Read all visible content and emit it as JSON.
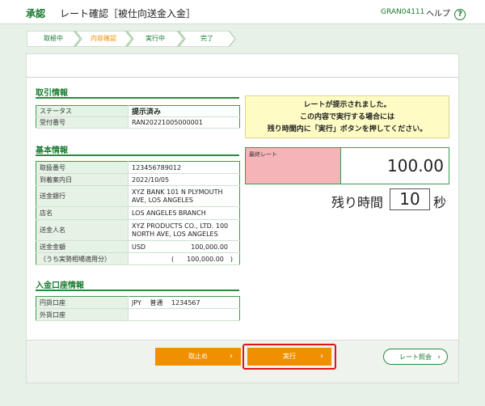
{
  "header": {
    "app_label": "承認",
    "title": "レート確認［被仕向送金入金］",
    "screen_code": "GRAN04111",
    "help_label": "ヘルプ",
    "help_icon_glyph": "?"
  },
  "steps": [
    {
      "label": "取極中"
    },
    {
      "label": "内容確認",
      "active": true
    },
    {
      "label": "実行中"
    },
    {
      "label": "完了"
    }
  ],
  "transaction": {
    "section_title": "取引情報",
    "rows": [
      {
        "label": "ステータス",
        "value": "提示済み"
      },
      {
        "label": "受付番号",
        "value": "RAN20221005000001"
      }
    ]
  },
  "basic": {
    "section_title": "基本情報",
    "rows": [
      {
        "label": "取扱番号",
        "value": "123456789012"
      },
      {
        "label": "到着案内日",
        "value": "2022/10/05"
      },
      {
        "label": "送金銀行",
        "value": "XYZ BANK 101 N PLYMOUTH AVE, LOS ANGELES"
      },
      {
        "label": "店名",
        "value": "LOS ANGELES BRANCH"
      },
      {
        "label": "送金人名",
        "value": "XYZ PRODUCTS CO., LTD. 100 NORTH AVE, LOS ANGELES"
      },
      {
        "label": "送金金額",
        "currency": "USD",
        "value": "100,000.00"
      },
      {
        "label": "（うち実勢相場適用分）",
        "value": "(　　100,000.00　)"
      }
    ]
  },
  "deposit": {
    "section_title": "入金口座情報",
    "rows": [
      {
        "label": "円貨口座",
        "value": "JPY　 普通　 1234567"
      },
      {
        "label": "外貨口座",
        "value": ""
      }
    ]
  },
  "notice": {
    "line1": "レートが提示されました。",
    "line2": "この内容で実行する場合には",
    "line3": "残り時間内に「実行」ボタンを押してください。"
  },
  "rate": {
    "label": "最終レート",
    "value": "100.00"
  },
  "timer": {
    "label": "残り時間",
    "value": "10",
    "unit": "秒"
  },
  "buttons": {
    "cancel": "取止め",
    "execute": "実行",
    "rate_inquiry": "レート照会",
    "arrow_glyph": "›"
  },
  "colors": {
    "brand_green": "#1a7a30",
    "button_orange": "#f09000",
    "highlight_red": "#e0121b",
    "notice_yellow": "#fefcc4",
    "rate_label_pink": "#f4b4b8",
    "background": "#e7f1e7"
  }
}
